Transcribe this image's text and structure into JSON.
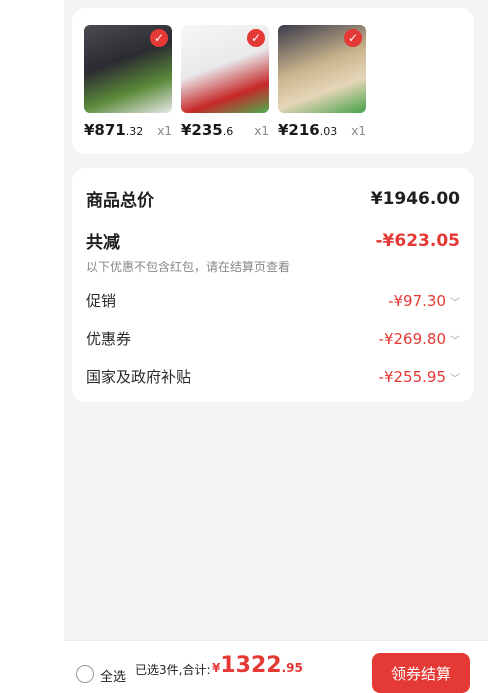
{
  "products": [
    {
      "price_int": "¥871",
      "price_dec": ".32",
      "qty": "x1"
    },
    {
      "price_int": "¥235",
      "price_dec": ".6",
      "qty": "x1"
    },
    {
      "price_int": "¥216",
      "price_dec": ".03",
      "qty": "x1"
    }
  ],
  "summary": {
    "total_label": "商品总价",
    "total_value": "¥1946.00",
    "discount_label": "共减",
    "discount_value": "-¥623.05",
    "discount_note": "以下优惠不包含红包，请在结算页查看",
    "promo_label": "促销",
    "promo_value": "-¥97.30",
    "coupon_label": "优惠券",
    "coupon_value": "-¥269.80",
    "subsidy_label": "国家及政府补贴",
    "subsidy_value": "-¥255.95"
  },
  "footer": {
    "select_all": "全选",
    "selected_text": "已选3件,合计:",
    "total_currency": "¥",
    "total_int": "1322",
    "total_dec": ".95",
    "checkout_button": "领券结算"
  },
  "colors": {
    "accent": "#e53935"
  }
}
